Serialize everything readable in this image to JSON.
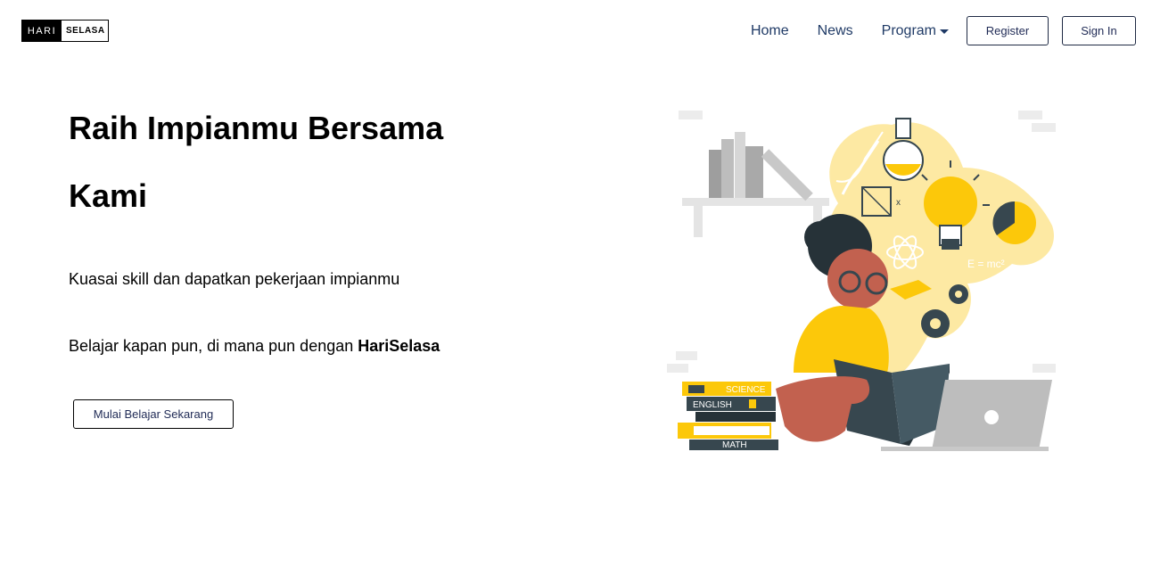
{
  "logo": {
    "part1": "HARI",
    "part2": "SELASA"
  },
  "nav": {
    "home": "Home",
    "news": "News",
    "program": "Program",
    "register": "Register",
    "signin": "Sign In"
  },
  "hero": {
    "title": "Raih Impianmu Bersama Kami",
    "subtitle": "Kuasai skill dan dapatkan pekerjaan impianmu",
    "tagline_prefix": "Belajar kapan pun, di mana pun dengan ",
    "tagline_brand": "HariSelasa",
    "cta": "Mulai Belajar Sekarang"
  },
  "illustration": {
    "book_labels": [
      "SCIENCE",
      "ENGLISH",
      "MATH"
    ],
    "formula": "E = mc²",
    "colors": {
      "yellow": "#fcc80a",
      "pale_yellow": "#fde9a3",
      "dark_teal": "#37474f",
      "skin": "#c2614f",
      "gray": "#bdbdbd"
    }
  }
}
